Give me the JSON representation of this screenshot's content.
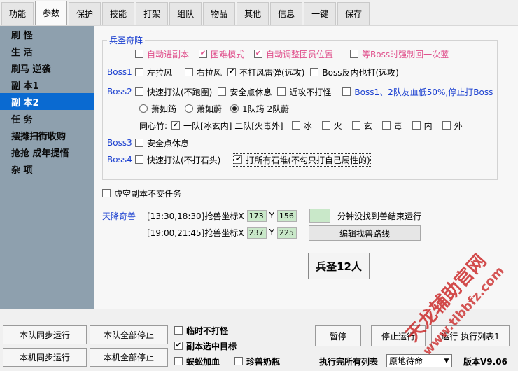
{
  "tabs": [
    "功能",
    "参数",
    "保护",
    "技能",
    "打架",
    "组队",
    "物品",
    "其他",
    "信息",
    "一键",
    "保存"
  ],
  "sidebar": [
    "刷 怪",
    "生 活",
    "刷马 逆袭",
    "副 本1",
    "副 本2",
    "任 务",
    "摆摊扫街收购",
    "抢抢 成年提悟",
    "杂 项"
  ],
  "group_title": "兵圣奇阵",
  "row0": [
    {
      "label": "自动进副本",
      "checked": false
    },
    {
      "label": "困难模式",
      "checked": true
    },
    {
      "label": "自动调整团员位置",
      "checked": true
    },
    {
      "label": "等Boss时强制回一次蓝",
      "checked": false
    }
  ],
  "boss1": {
    "label": "Boss1",
    "opts": [
      {
        "label": "左拉风",
        "checked": false
      },
      {
        "label": "右拉风",
        "checked": false
      },
      {
        "label": "不打风雷弹(远攻)",
        "checked": true
      },
      {
        "label": "Boss反内也打(远攻)",
        "checked": false
      }
    ]
  },
  "boss2": {
    "label": "Boss2",
    "opts": [
      {
        "label": "快速打法(不跑圈)",
        "checked": false
      },
      {
        "label": "安全点休息",
        "checked": false
      },
      {
        "label": "近攻不打怪",
        "checked": false
      }
    ],
    "hp_opt": {
      "label": "Boss1、2队友血低50%,停止打Boss",
      "checked": false
    },
    "radios": [
      {
        "label": "萧如筠",
        "checked": false
      },
      {
        "label": "萧如蔚",
        "checked": false
      },
      {
        "label": "1队筠 2队蔚",
        "checked": true
      }
    ],
    "xin_label": "同心竹:",
    "xin_opts": [
      {
        "label": "一队[冰玄内] 二队[火毒外]",
        "checked": true
      },
      {
        "label": "冰",
        "checked": false
      },
      {
        "label": "火",
        "checked": false
      },
      {
        "label": "玄",
        "checked": false
      },
      {
        "label": "毒",
        "checked": false
      },
      {
        "label": "内",
        "checked": false
      },
      {
        "label": "外",
        "checked": false
      }
    ]
  },
  "boss3": {
    "label": "Boss3",
    "opts": [
      {
        "label": "安全点休息",
        "checked": false
      }
    ]
  },
  "boss4": {
    "label": "Boss4",
    "opts": [
      {
        "label": "快速打法(不打石头)",
        "checked": false
      },
      {
        "label": "打所有石堆(不勾只打自己属性的)",
        "checked": true
      }
    ]
  },
  "void_task": {
    "label": "虚空副本不交任务",
    "checked": false
  },
  "beast": {
    "label": "天降奇兽",
    "time1": "[13:30,18:30]抢兽坐标X",
    "x1": "173",
    "y_label": "Y",
    "y1": "156",
    "time2": "[19:00,21:45]抢兽坐标X",
    "x2": "237",
    "y2": "225",
    "minute_value": "",
    "minute_label": "分钟没找到兽结束运行",
    "edit_btn": "编辑找兽路线"
  },
  "big_btn": "兵圣12人",
  "bottom": {
    "b1": "本队同步运行",
    "b2": "本队全部停止",
    "b3": "本机同步运行",
    "b4": "本机全部停止",
    "c1": {
      "label": "临时不打怪",
      "checked": false
    },
    "c2": {
      "label": "副本选中目标",
      "checked": true
    },
    "c3": {
      "label": "蜈蚣加血",
      "checked": false
    },
    "c4": {
      "label": "珍兽奶瓶",
      "checked": false
    },
    "pause": "暂停",
    "stop": "停止运行",
    "run": "运行 执行列表1",
    "list_label": "执行完所有列表",
    "select": "原地待命",
    "version": "版本V9.06"
  },
  "watermark1": "天龙辅助官网",
  "watermark2": "www.tlbbfz.com"
}
